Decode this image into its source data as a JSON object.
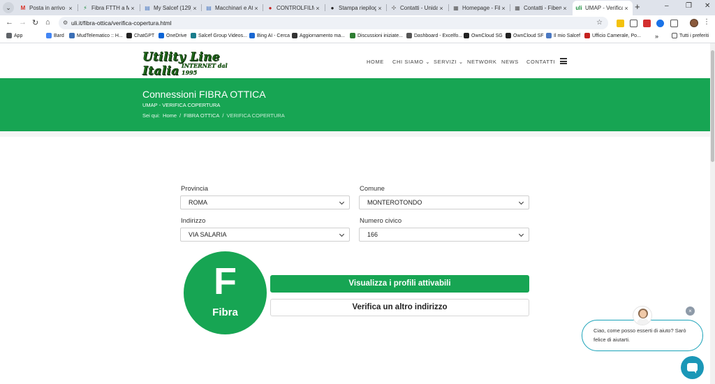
{
  "browser": {
    "tabs": [
      {
        "title": "Posta in arrivo - fr",
        "icon": "gmail-icon",
        "color": "#d93025",
        "glyph": "M"
      },
      {
        "title": "Fibra FTTH a Mo",
        "icon": "bolt-icon",
        "color": "#1e8e3e",
        "glyph": "⚡"
      },
      {
        "title": "My Salcef (129)",
        "icon": "doc-icon",
        "color": "#4a78c2",
        "glyph": "▤"
      },
      {
        "title": "Macchinari e Attr",
        "icon": "doc-icon",
        "color": "#4a78c2",
        "glyph": "▤"
      },
      {
        "title": "CONTROLFILM - T",
        "icon": "record-icon",
        "color": "#c5221f",
        "glyph": "●"
      },
      {
        "title": "Stampa riepiloge",
        "icon": "globe-icon",
        "color": "#222222",
        "glyph": "●"
      },
      {
        "title": "Contatti - Unidata",
        "icon": "puzzle-icon",
        "color": "#777777",
        "glyph": "✣"
      },
      {
        "title": "Homepage - Fibe",
        "icon": "page-icon",
        "color": "#555555",
        "glyph": "▦"
      },
      {
        "title": "Contatti - FiberCo",
        "icon": "page-icon",
        "color": "#555555",
        "glyph": "▦"
      },
      {
        "title": "UMAP - Verifica C",
        "icon": "uli-icon",
        "color": "#1e8e3e",
        "glyph": "uli"
      }
    ],
    "url": "uli.it/fibra-ottica/verifica-copertura.html",
    "bookmarks": [
      {
        "label": "App",
        "color": "#5f6368"
      },
      {
        "label": "Bard",
        "color": "#4285f4"
      },
      {
        "label": "MudTelematico :: H...",
        "color": "#3b6fb6"
      },
      {
        "label": "ChatGPT",
        "color": "#222222"
      },
      {
        "label": "OneDrive",
        "color": "#0a64d6"
      },
      {
        "label": "Salcef Group Videos...",
        "color": "#1a7d8c"
      },
      {
        "label": "Bing AI - Cerca",
        "color": "#1967d2"
      },
      {
        "label": "Aggiornamento ma...",
        "color": "#333333"
      },
      {
        "label": "Discussioni iniziate...",
        "color": "#2e7d32"
      },
      {
        "label": "Dashboard - Excelfo...",
        "color": "#555555"
      },
      {
        "label": "OwnCloud SG",
        "color": "#222222"
      },
      {
        "label": "OwnCloud SF",
        "color": "#222222"
      },
      {
        "label": "Il mio Salcef",
        "color": "#4a78c2"
      },
      {
        "label": "Ufficio Camerale, Po...",
        "color": "#c5221f"
      }
    ],
    "bookmarks_more": "Tutti i preferiti"
  },
  "site": {
    "logo_line1": "Utility Line Italia",
    "logo_line2": "INTERNET dal 1995",
    "nav": [
      "HOME",
      "CHI SIAMO ⌄",
      "SERVIZI ⌄",
      "NETWORK",
      "NEWS",
      "CONTATTI"
    ],
    "brand_green": "#17a553"
  },
  "hero": {
    "title": "Connessioni FIBRA OTTICA",
    "subtitle": "UMAP - VERIFICA COPERTURA",
    "breadcrumb_prefix": "Sei qui:",
    "breadcrumb": [
      "Home",
      "FIBRA OTTICA",
      "VERIFICA COPERTURA"
    ]
  },
  "form": {
    "provincia_label": "Provincia",
    "provincia_value": "ROMA",
    "comune_label": "Comune",
    "comune_value": "MONTEROTONDO",
    "indirizzo_label": "Indirizzo",
    "indirizzo_value": "VIA SALARIA",
    "civico_label": "Numero civico",
    "civico_value": "166"
  },
  "result": {
    "letter": "F",
    "word": "Fibra",
    "primary_button": "Visualizza i profili attivabili",
    "secondary_button": "Verifica un altro indirizzo"
  },
  "chat": {
    "message": "Ciao, come posso esserti di aiuto? Sarò felice di aiutarti.",
    "close": "×"
  }
}
